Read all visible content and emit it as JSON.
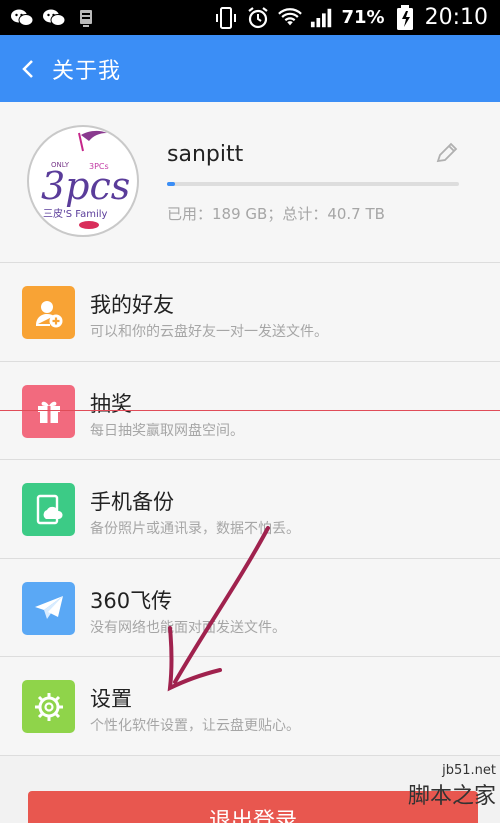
{
  "status_bar": {
    "icons_left": [
      "wechat-icon",
      "wechat-icon",
      "storage-icon"
    ],
    "icons_right": [
      "vibrate-icon",
      "alarm-icon",
      "wifi-icon",
      "signal-icon"
    ],
    "battery_text": "71%",
    "time": "20:10"
  },
  "app_bar": {
    "title": "关于我",
    "back_icon": "chevron-left-icon",
    "background_color": "#3b8ef6"
  },
  "profile": {
    "username": "sanpitt",
    "quota_used_fraction": 0.004,
    "quota_text": "已用：189 GB；总计：40.7 TB",
    "avatar_text": "三皮'S Family",
    "avatar_big": "3pcs",
    "avatar_small": "3PCs",
    "avatar_only": "ONLY"
  },
  "menu_items": [
    {
      "title": "我的好友",
      "subtitle": "可以和你的云盘好友一对一发送文件。",
      "icon": "add-friend-icon",
      "color": "#f8a335"
    },
    {
      "title": "抽奖",
      "subtitle": "每日抽奖赢取网盘空间。",
      "icon": "gift-icon",
      "color": "#f26a7e"
    },
    {
      "title": "手机备份",
      "subtitle": "备份照片或通讯录，数据不怕丢。",
      "icon": "phone-backup-icon",
      "color": "#3ccb86"
    },
    {
      "title": "360飞传",
      "subtitle": "没有网络也能面对面发送文件。",
      "icon": "paper-plane-icon",
      "color": "#5aa8f5"
    },
    {
      "title": "设置",
      "subtitle": "个性化软件设置，让云盘更贴心。",
      "icon": "gear-icon",
      "color": "#8fd44a"
    }
  ],
  "logout_label": "退出登录",
  "watermark": {
    "site": "jb51.net",
    "name": "脚本之家"
  }
}
